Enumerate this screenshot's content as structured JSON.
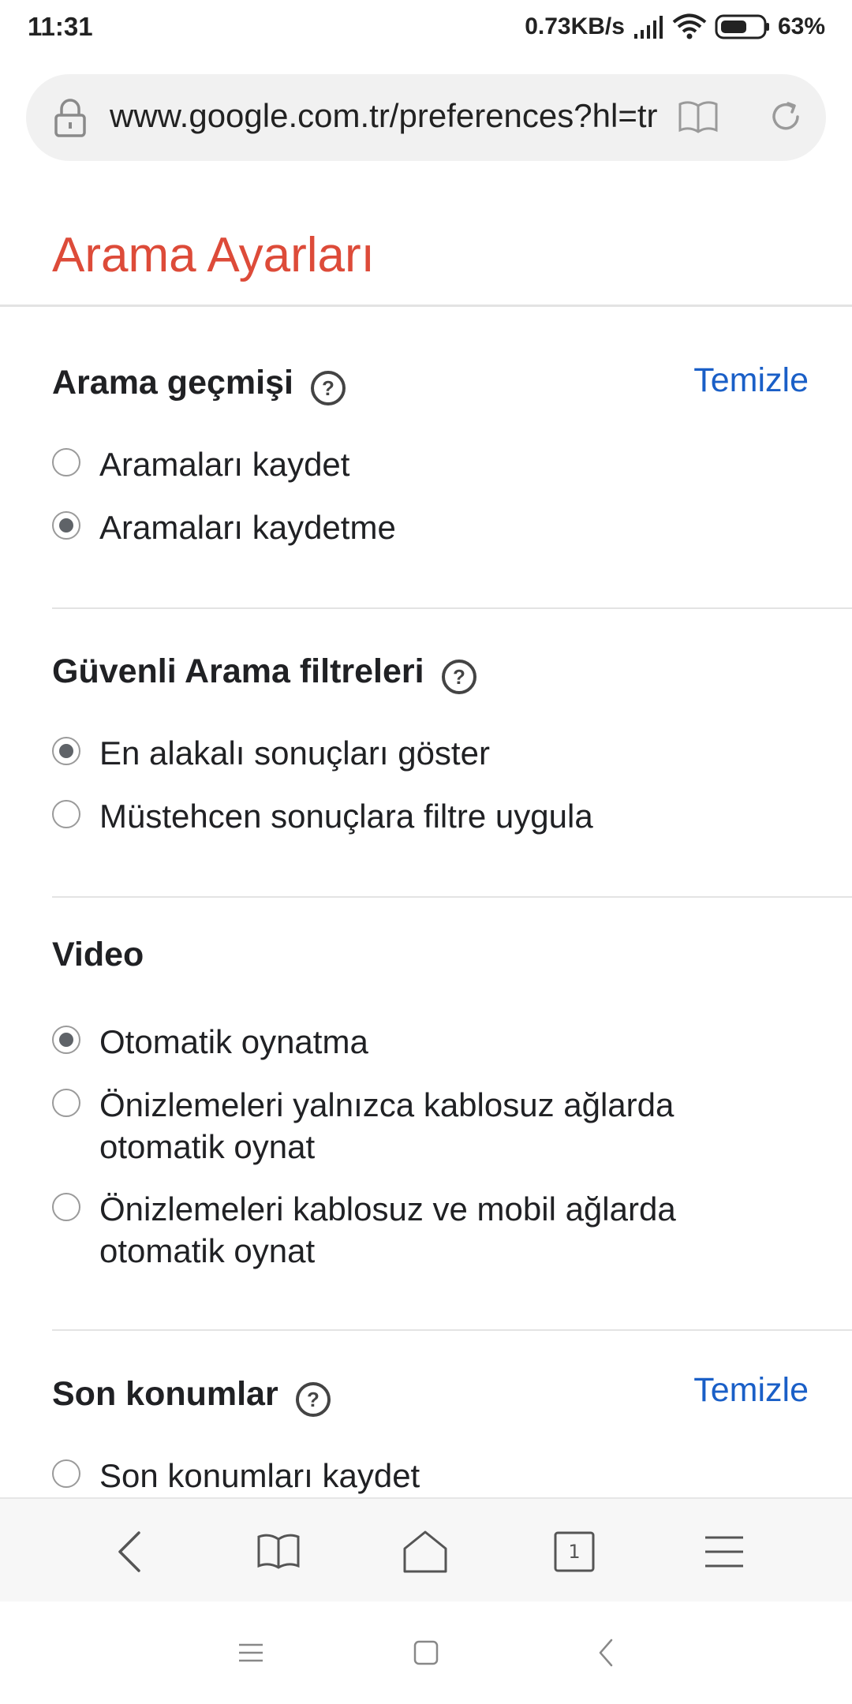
{
  "status_bar": {
    "time": "11:31",
    "speed": "0.73KB/s",
    "battery_pct": "63%",
    "battery_level": 0.63
  },
  "url_bar": {
    "url": "www.google.com.tr/preferences?hl=tr"
  },
  "page": {
    "title": "Arama Ayarları"
  },
  "sections": {
    "history": {
      "heading": "Arama geçmişi",
      "clear_label": "Temizle",
      "options": [
        {
          "label": "Aramaları kaydet",
          "checked": false
        },
        {
          "label": "Aramaları kaydetme",
          "checked": true
        }
      ]
    },
    "safesearch": {
      "heading": "Güvenli Arama filtreleri",
      "options": [
        {
          "label": "En alakalı sonuçları göster",
          "checked": true
        },
        {
          "label": "Müstehcen sonuçlara filtre uygula",
          "checked": false
        }
      ]
    },
    "video": {
      "heading": "Video",
      "options": [
        {
          "label": "Otomatik oynatma",
          "checked": true
        },
        {
          "label": "Önizlemeleri yalnızca kablosuz ağlarda otomatik oynat",
          "checked": false
        },
        {
          "label": "Önizlemeleri kablosuz ve mobil ağlarda otomatik oynat",
          "checked": false
        }
      ]
    },
    "locations": {
      "heading": "Son konumlar",
      "clear_label": "Temizle",
      "options": [
        {
          "label": "Son konumları kaydet",
          "checked": false
        }
      ]
    }
  },
  "toolbar": {
    "tab_count": "1",
    "icons": [
      "back-icon",
      "bookmarks-icon",
      "home-icon",
      "tabs-icon",
      "menu-icon"
    ]
  },
  "system_nav": {
    "icons": [
      "recents-icon",
      "home-square-icon",
      "back-chevron-icon"
    ]
  },
  "colors": {
    "title": "#dd4b39",
    "link": "#1a5fc7",
    "radio_checked": "#5f6368"
  }
}
